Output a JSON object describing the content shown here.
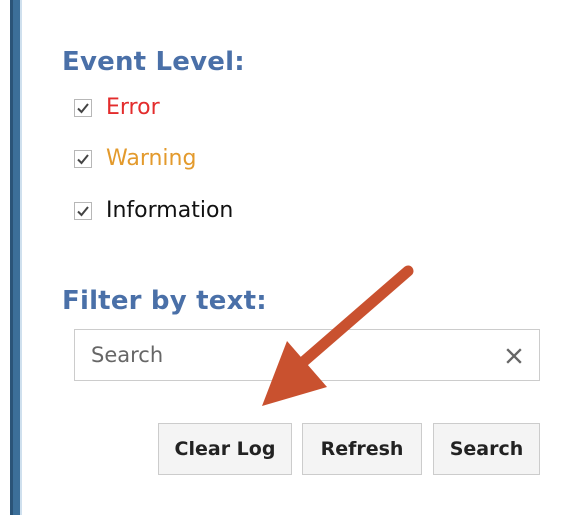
{
  "event_level": {
    "title": "Event Level:",
    "options": [
      {
        "label": "Error",
        "checked": true,
        "color": "#e32c2c"
      },
      {
        "label": "Warning",
        "checked": true,
        "color": "#e39a2c"
      },
      {
        "label": "Information",
        "checked": true,
        "color": "#111111"
      }
    ]
  },
  "filter": {
    "title": "Filter by text:",
    "search_placeholder": "Search",
    "search_value": "",
    "clear_icon": "close-icon"
  },
  "buttons": {
    "clear_log": "Clear Log",
    "refresh": "Refresh",
    "search": "Search"
  },
  "colors": {
    "accent_title": "#4a70a8",
    "annotation_arrow": "#c9512f",
    "left_strip": "#3c6f99"
  }
}
